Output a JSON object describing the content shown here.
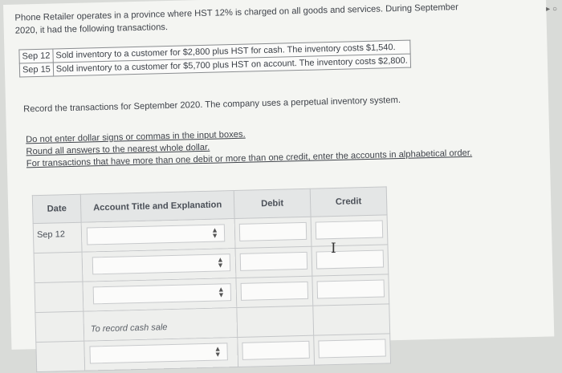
{
  "intro": {
    "line1": "Phone Retailer operates in a province where HST 12% is charged on all goods and services. During September",
    "line2": "2020, it had the following transactions."
  },
  "transactions": [
    {
      "date": "Sep 12",
      "text": "Sold inventory to a customer for $2,800 plus HST for cash. The inventory costs $1,540."
    },
    {
      "date": "Sep 15",
      "text": "Sold inventory to a customer for $5,700 plus HST on account. The inventory costs $2,800."
    }
  ],
  "instruction": "Record the transactions for September 2020. The company uses a perpetual inventory system.",
  "notes": [
    "Do not enter dollar signs or commas in the input boxes.",
    "Round all answers to the nearest whole dollar.",
    "For transactions that have more than one debit or more than one credit, enter the accounts in alphabetical order."
  ],
  "journal": {
    "headers": {
      "date": "Date",
      "account": "Account Title and Explanation",
      "debit": "Debit",
      "credit": "Credit"
    },
    "rows": [
      {
        "date": "Sep 12"
      },
      {
        "date": ""
      },
      {
        "date": ""
      },
      {
        "date": "",
        "explanation": "To record cash sale"
      },
      {
        "date": ""
      }
    ]
  },
  "icons": {
    "select_arrows": "updown-arrows-icon",
    "text_cursor": "ibeam-cursor-icon"
  }
}
